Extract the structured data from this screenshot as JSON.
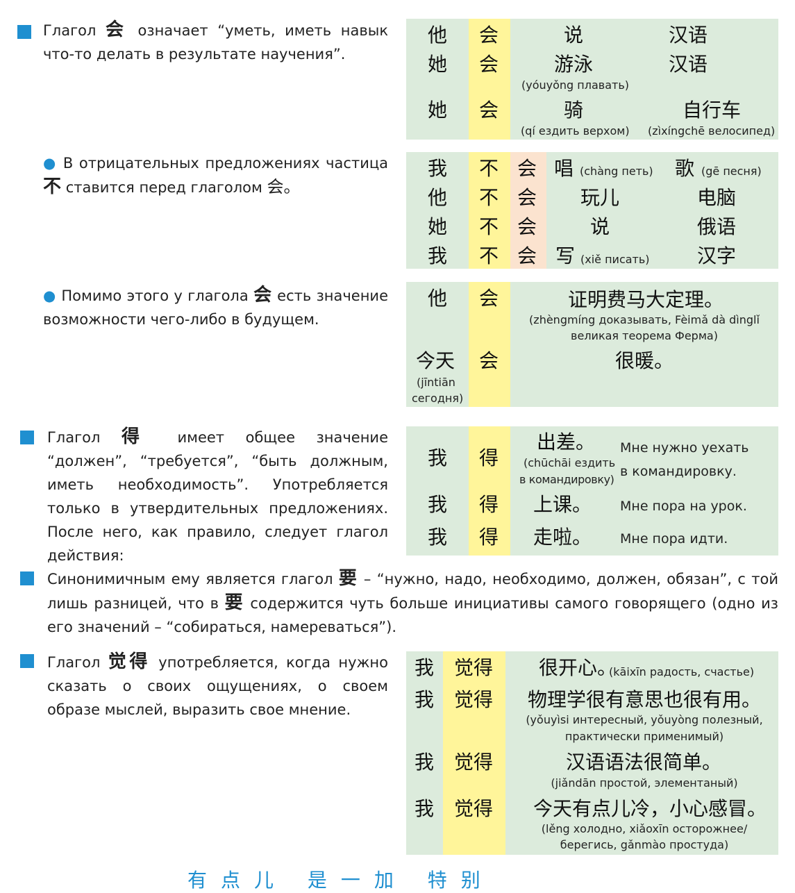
{
  "s1": {
    "pre": "Глагол ",
    "kw": "会",
    "post": " означает “уметь, иметь навык что-то делать в результате научения”.",
    "rows": [
      {
        "subj": "他",
        "verb": "会",
        "w1": "说",
        "w2": "汉语",
        "g1": "",
        "g2": ""
      },
      {
        "subj": "她",
        "verb": "会",
        "w1": "游泳",
        "w2": "汉语",
        "g1": "(yóuyǒng плавать)",
        "g2": ""
      },
      {
        "subj": "她",
        "verb": "会",
        "w1": "骑",
        "w2": "自行车",
        "g1": "(qí ездить верхом)",
        "g2": "(zìxíngchē велосипед)"
      }
    ]
  },
  "s2": {
    "pre": " В отрицательных предложениях частица ",
    "kw": "不",
    "mid": " ставится перед глаголом ",
    "kw2": "会。",
    "rows": [
      {
        "subj": "我",
        "neg": "不",
        "verb": "会",
        "w1": "唱",
        "g1": "(chàng петь)",
        "w2": "歌",
        "g2": "(gē песня)"
      },
      {
        "subj": "他",
        "neg": "不",
        "verb": "会",
        "w1": "玩儿",
        "g1": "",
        "w2": "电脑",
        "g2": ""
      },
      {
        "subj": "她",
        "neg": "不",
        "verb": "会",
        "w1": "说",
        "g1": "",
        "w2": "俄语",
        "g2": ""
      },
      {
        "subj": "我",
        "neg": "不",
        "verb": "会",
        "w1": "写",
        "g1": "(xiě писать)",
        "w2": "汉字",
        "g2": ""
      }
    ]
  },
  "s3": {
    "pre": " Помимо этого у глагола ",
    "kw": "会",
    "post": " есть значение возможности чего-либо в будущем.",
    "r1": {
      "subj": "他",
      "verb": "会",
      "sent": "证明费马大定理。",
      "gloss1": "(zhèngmíng доказывать, Fèimǎ dà dìnglǐ",
      "gloss2": "великая теорема Ферма)"
    },
    "r2": {
      "subj": "今天",
      "sg1": "(jīntiān",
      "sg2": "сегодня)",
      "verb": "会",
      "sent": "很暖。"
    }
  },
  "s4": {
    "pre": "Глагол ",
    "kw": "得",
    "post": " имеет общее значение “должен”, “требуется”, “быть должным, иметь необходимость”. Употребляется только в утвердительных предложениях. После него, как правило, следует глагол действия:",
    "rows": [
      {
        "subj": "我",
        "verb": "得",
        "w": "出差。",
        "g1": "(chūchāi ездить",
        "g2": "в командировку)",
        "ru1": "Мне нужно уехать",
        "ru2": "в командировку."
      },
      {
        "subj": "我",
        "verb": "得",
        "w": "上课。",
        "g1": "",
        "g2": "",
        "ru1": "Мне пора на урок.",
        "ru2": ""
      },
      {
        "subj": "我",
        "verb": "得",
        "w": "走啦。",
        "g1": "",
        "g2": "",
        "ru1": "Мне пора идти.",
        "ru2": ""
      }
    ]
  },
  "s5": {
    "pre": "Синонимичным ему является глагол ",
    "kw": "要",
    "mid": " – “нужно, надо, необходимо, должен, обязан”, с той лишь разницей, что в ",
    "kw2": "要",
    "post": " содержится чуть больше инициативы самого говорящего (одно из его значений – “собираться, намереваться”)."
  },
  "s6": {
    "pre": "Глагол ",
    "kw": "觉得",
    "post": " употребляется, когда нужно сказать о своих ощущениях, о своем образе мыслей, выразить свое мнение.",
    "rows": [
      {
        "subj": "我",
        "verb": "觉得",
        "sent": "很开心。",
        "inline": "(kāixīn радость, счастье)",
        "g1": "",
        "g2": ""
      },
      {
        "subj": "我",
        "verb": "觉得",
        "sent": "物理学很有意思也很有用。",
        "inline": "",
        "g1": "(yǒuyìsi интересный, yǒuyòng полезный,",
        "g2": "практически применимый)"
      },
      {
        "subj": "我",
        "verb": "觉得",
        "sent": "汉语语法很简单。",
        "inline": "",
        "g1": "(jiǎndān простой, элементаный)",
        "g2": ""
      },
      {
        "subj": "我",
        "verb": "觉得",
        "sent": "今天有点儿冷，小心感冒。",
        "inline": "",
        "g1": "(lěng холодно, xiǎoxīn осторожнее/",
        "g2": "берегись, gǎnmào простуда)"
      }
    ]
  },
  "footer": {
    "partial": "有点儿 是一加 特别"
  },
  "colors": {
    "bullet": "#1f8fd0",
    "box": "#dcebdc",
    "highlight_yellow": "#fff59a",
    "highlight_peach": "#fbe3cf"
  }
}
